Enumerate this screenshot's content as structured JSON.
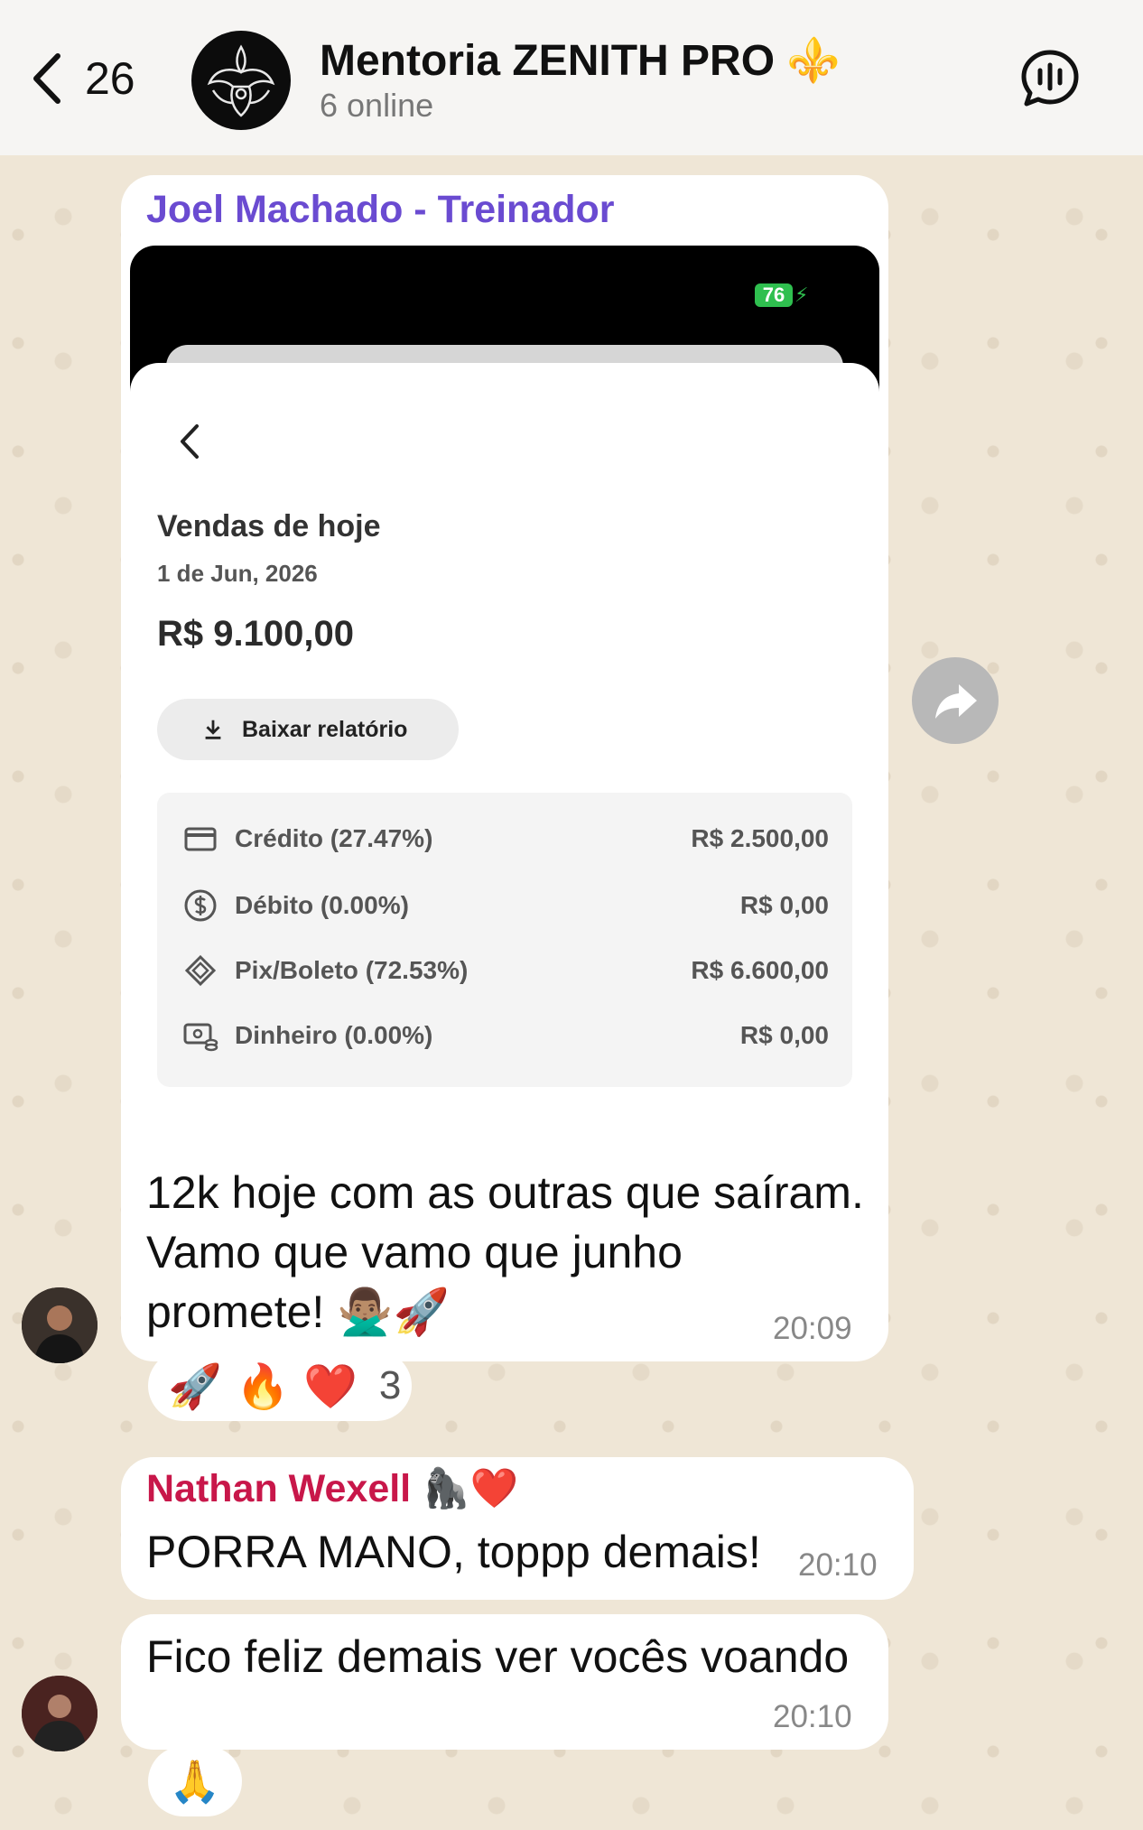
{
  "header": {
    "back_count": "26",
    "title": "Mentoria ZENITH PRO ⚜️",
    "subtitle": "6 online"
  },
  "messages": [
    {
      "sender": "Joel Machado - Treinador",
      "sender_color": "#6a4bd1",
      "attachment": {
        "battery": "76",
        "card_title": "Vendas de hoje",
        "card_date": "1 de Jun, 2026",
        "card_total": "R$ 9.100,00",
        "download_label": "Baixar relatório",
        "payments": [
          {
            "icon": "credit-card-icon",
            "label": "Crédito (27.47%)",
            "value": "R$ 2.500,00"
          },
          {
            "icon": "dollar-circle-icon",
            "label": "Débito (0.00%)",
            "value": "R$ 0,00"
          },
          {
            "icon": "pix-icon",
            "label": "Pix/Boleto (72.53%)",
            "value": "R$ 6.600,00"
          },
          {
            "icon": "cash-icon",
            "label": "Dinheiro (0.00%)",
            "value": "R$ 0,00"
          }
        ]
      },
      "text": "12k hoje com as outras que saíram. Vamo que vamo que junho promete! 🙅🏽‍♂️🚀",
      "time": "20:09",
      "reactions": {
        "emojis": "🚀 🔥 ❤️",
        "count": "3"
      }
    },
    {
      "sender": "Nathan Wexell 🦍❤️",
      "sender_color": "#c8174a",
      "text": "PORRA MANO, toppp demais!",
      "time": "20:10"
    },
    {
      "text": "Fico feliz demais ver vocês voando",
      "time": "20:10",
      "reactions": {
        "emojis": "🙏"
      }
    }
  ]
}
